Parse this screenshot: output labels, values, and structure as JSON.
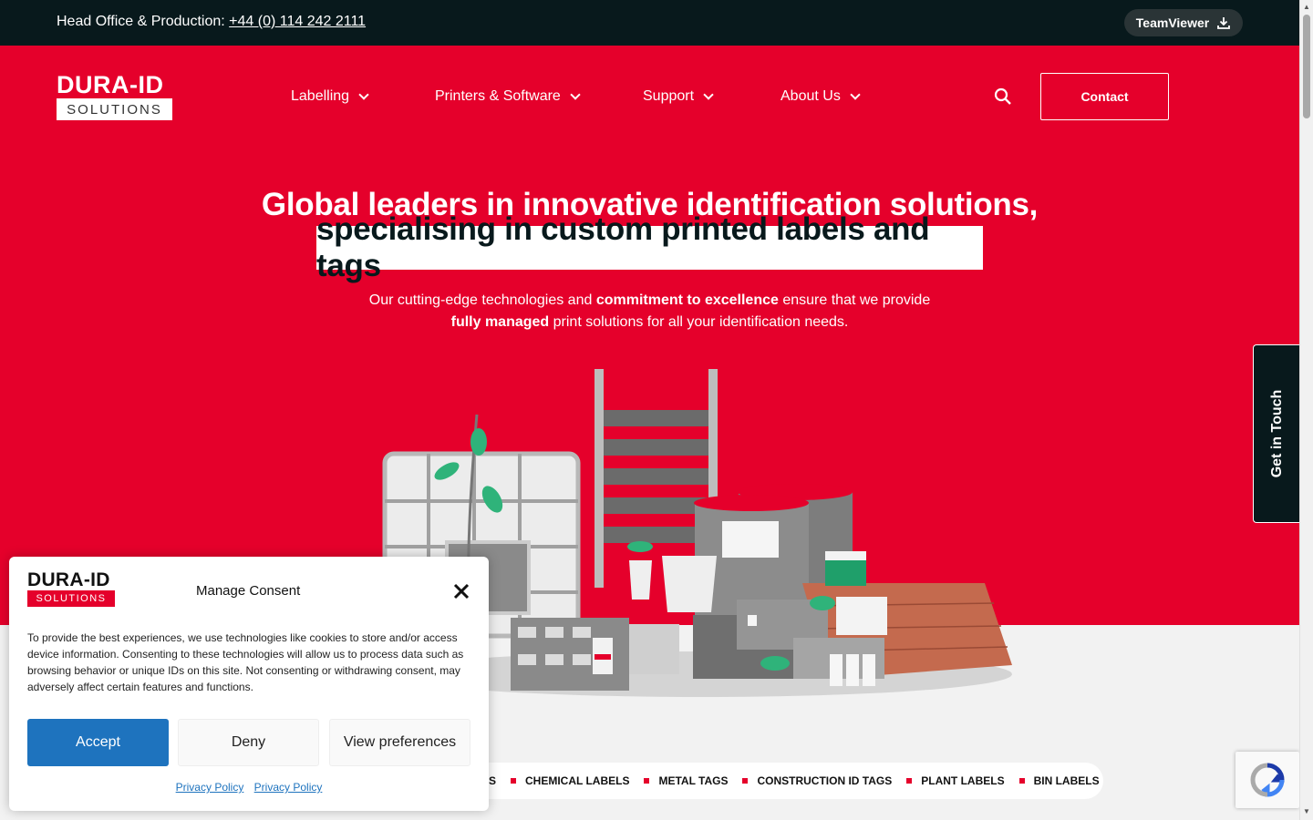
{
  "topbar": {
    "office_label": "Head Office & Production:",
    "phone": "+44 (0) 114 242 2111",
    "teamviewer_label": "TeamViewer"
  },
  "logo": {
    "line1": "DURA-ID",
    "line2": "SOLUTIONS"
  },
  "nav": {
    "items": [
      {
        "label": "Labelling"
      },
      {
        "label": "Printers & Software"
      },
      {
        "label": "Support"
      },
      {
        "label": "About Us"
      }
    ],
    "contact_label": "Contact"
  },
  "hero": {
    "headline_1": "Global leaders in innovative identification solutions,",
    "headline_2": "specialising in custom printed labels and tags",
    "sub_1a": "Our cutting-edge technologies and ",
    "sub_1b": "commitment to excellence",
    "sub_1c": " ensure that we provide",
    "sub_2a": "fully managed",
    "sub_2b": " print solutions for all your identification needs."
  },
  "side_tab": {
    "label": "Get in Touch"
  },
  "tags": [
    "S",
    "CHEMICAL LABELS",
    "METAL TAGS",
    "CONSTRUCTION ID TAGS",
    "PLANT LABELS",
    "BIN LABELS"
  ],
  "consent": {
    "title": "Manage Consent",
    "text": "To provide the best experiences, we use technologies like cookies to store and/or access device information. Consenting to these technologies will allow us to process data such as browsing behavior or unique IDs on this site. Not consenting or withdrawing consent, may adversely affect certain features and functions.",
    "accept": "Accept",
    "deny": "Deny",
    "prefs": "View preferences",
    "link1": "Privacy Policy",
    "link2": "Privacy Policy"
  },
  "colors": {
    "brand_red": "#e5002b",
    "dark": "#08191c",
    "accept_blue": "#1e73be"
  }
}
